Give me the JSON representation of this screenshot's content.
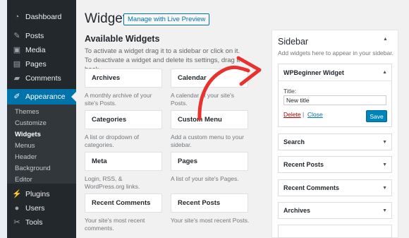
{
  "admin_menu": {
    "items": [
      {
        "label": "Dashboard",
        "icon": "dashboard-icon",
        "glyph": "◔"
      },
      {
        "label": "Posts",
        "icon": "pin-icon",
        "glyph": "✎"
      },
      {
        "label": "Media",
        "icon": "media-icon",
        "glyph": "▣"
      },
      {
        "label": "Pages",
        "icon": "pages-icon",
        "glyph": "▤"
      },
      {
        "label": "Comments",
        "icon": "comments-icon",
        "glyph": "▰"
      },
      {
        "label": "Appearance",
        "icon": "brush-icon",
        "glyph": "✐"
      },
      {
        "label": "Plugins",
        "icon": "plug-icon",
        "glyph": "⚡"
      },
      {
        "label": "Users",
        "icon": "users-icon",
        "glyph": "●"
      },
      {
        "label": "Tools",
        "icon": "wrench-icon",
        "glyph": "✂"
      }
    ],
    "submenu": [
      "Themes",
      "Customize",
      "Widgets",
      "Menus",
      "Header",
      "Background",
      "Editor"
    ]
  },
  "header": {
    "title": "Widgets",
    "manage_preview_label": "Manage with Live Preview"
  },
  "available": {
    "title": "Available Widgets",
    "description": "To activate a widget drag it to a sidebar or click on it. To deactivate a widget and delete its settings, drag it back.",
    "widgets": [
      {
        "title": "Archives",
        "desc": "A monthly archive of your site's Posts."
      },
      {
        "title": "Calendar",
        "desc": "A calendar of your site's Posts."
      },
      {
        "title": "Categories",
        "desc": "A list or dropdown of categories."
      },
      {
        "title": "Custom Menu",
        "desc": "Add a custom menu to your sidebar."
      },
      {
        "title": "Meta",
        "desc": "Login, RSS, & WordPress.org links."
      },
      {
        "title": "Pages",
        "desc": "A list of your site's Pages."
      },
      {
        "title": "Recent Comments",
        "desc": "Your site's most recent comments."
      },
      {
        "title": "Recent Posts",
        "desc": "Your site's most recent Posts."
      }
    ]
  },
  "sidebar": {
    "title": "Sidebar",
    "description": "Add widgets here to appear in your sidebar.",
    "open_widget": {
      "title": "WPBeginner Widget",
      "field_label": "Title:",
      "field_value": "New title",
      "delete_label": "Delete",
      "separator": "|",
      "close_label": "Close",
      "save_label": "Save"
    },
    "widgets": [
      "Search",
      "Recent Posts",
      "Recent Comments",
      "Archives"
    ]
  },
  "colors": {
    "admin_bg": "#23282d",
    "accent": "#0073aa",
    "annotation_arrow": "#e8322d"
  }
}
